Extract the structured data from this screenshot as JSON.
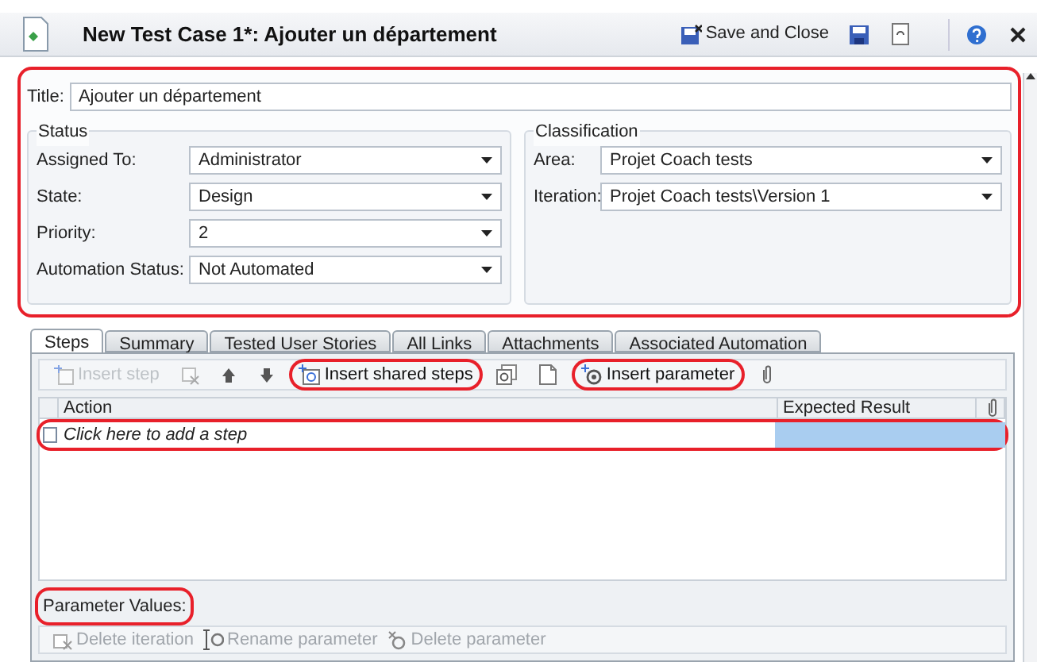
{
  "window": {
    "title": "New Test Case 1*: Ajouter un département",
    "actions": [
      {
        "kind": "save_close",
        "label": "Save and Close"
      },
      {
        "kind": "save"
      },
      {
        "kind": "refresh"
      },
      {
        "kind": "help"
      },
      {
        "kind": "close"
      }
    ]
  },
  "form": {
    "annotated": true,
    "title_label": "Title:",
    "title_value": "Ajouter un département",
    "status": {
      "legend": "Status",
      "fields": [
        {
          "label": "Assigned To:",
          "value": "Administrator"
        },
        {
          "label": "State:",
          "value": "Design"
        },
        {
          "label": "Priority:",
          "value": "2"
        },
        {
          "label": "Automation Status:",
          "value": "Not Automated"
        }
      ]
    },
    "classification": {
      "legend": "Classification",
      "fields": [
        {
          "label": "Area:",
          "value": "Projet Coach tests"
        },
        {
          "label": "Iteration:",
          "value": "Projet Coach tests\\Version 1"
        }
      ]
    }
  },
  "tabs": [
    {
      "label": "Steps",
      "selected": true
    },
    {
      "label": "Summary",
      "selected": false
    },
    {
      "label": "Tested User Stories",
      "selected": false
    },
    {
      "label": "All Links",
      "selected": false
    },
    {
      "label": "Attachments",
      "selected": false
    },
    {
      "label": "Associated Automation",
      "selected": false
    }
  ],
  "steps_toolbar": [
    {
      "kind": "insert_step",
      "label": "Insert step",
      "disabled": true,
      "annotated": false
    },
    {
      "kind": "delete_step",
      "disabled": true,
      "annotated": false
    },
    {
      "kind": "move_up",
      "disabled": false,
      "annotated": false
    },
    {
      "kind": "move_down",
      "disabled": false,
      "annotated": false
    },
    {
      "kind": "insert_shared",
      "label": "Insert shared steps",
      "disabled": false,
      "annotated": true
    },
    {
      "kind": "shared_steps",
      "disabled": false,
      "annotated": false
    },
    {
      "kind": "new_document",
      "disabled": false,
      "annotated": false
    },
    {
      "kind": "insert_parameter",
      "label": "Insert parameter",
      "disabled": false,
      "annotated": true
    },
    {
      "kind": "attach",
      "disabled": false,
      "annotated": false
    }
  ],
  "grid": {
    "columns": [
      {
        "kind": "text",
        "label": "Action"
      },
      {
        "kind": "text",
        "label": "Expected Result"
      },
      {
        "kind": "attachment"
      }
    ],
    "new_row": {
      "placeholder": "Click here to add a step",
      "selected": true,
      "annotated": true
    }
  },
  "parameters": {
    "label": "Parameter Values:",
    "annotated": true,
    "toolbar": [
      {
        "kind": "delete_iteration",
        "label": "Delete iteration",
        "disabled": true
      },
      {
        "kind": "rename_parameter",
        "label": "Rename parameter",
        "disabled": true
      },
      {
        "kind": "delete_parameter",
        "label": "Delete parameter",
        "disabled": true
      }
    ]
  }
}
